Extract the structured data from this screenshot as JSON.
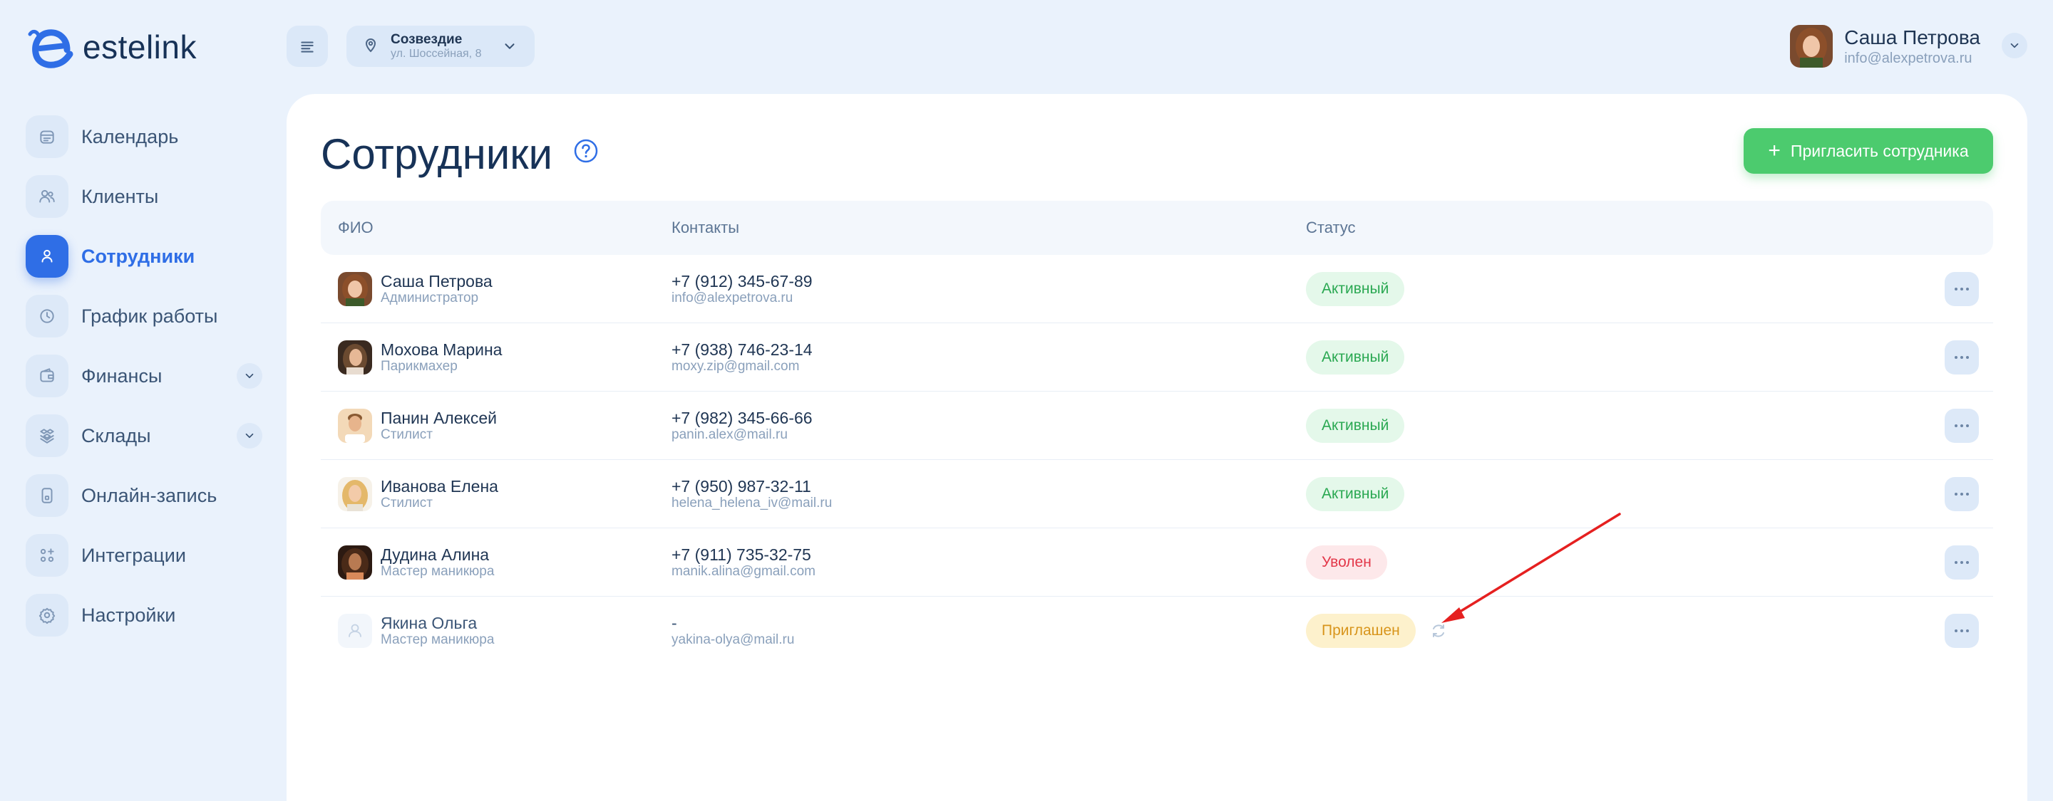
{
  "app": {
    "logo_text": "estelink"
  },
  "sidebar": {
    "items": [
      {
        "label": "Календарь",
        "icon": "calendar-icon"
      },
      {
        "label": "Клиенты",
        "icon": "clients-icon"
      },
      {
        "label": "Сотрудники",
        "icon": "user-icon",
        "active": true
      },
      {
        "label": "График работы",
        "icon": "clock-icon"
      },
      {
        "label": "Финансы",
        "icon": "wallet-icon",
        "expandable": true
      },
      {
        "label": "Склады",
        "icon": "boxes-icon",
        "expandable": true
      },
      {
        "label": "Онлайн-запись",
        "icon": "phone-icon"
      },
      {
        "label": "Интеграции",
        "icon": "integrations-icon"
      },
      {
        "label": "Настройки",
        "icon": "gear-icon"
      }
    ]
  },
  "topbar": {
    "location_name": "Созвездие",
    "location_address": "ул. Шоссейная, 8",
    "user_name": "Саша Петрова",
    "user_email": "info@alexpetrova.ru"
  },
  "main": {
    "title": "Сотрудники",
    "invite_label": "Пригласить сотрудника",
    "invite_plus": "+",
    "columns": {
      "name": "ФИО",
      "contacts": "Контакты",
      "status": "Статус"
    },
    "rows": [
      {
        "name": "Саша Петрова",
        "role": "Администратор",
        "phone": "+7 (912) 345-67-89",
        "email": "info@alexpetrova.ru",
        "status": "Активный",
        "status_type": "active"
      },
      {
        "name": "Мохова Марина",
        "role": "Парикмахер",
        "phone": "+7 (938) 746-23-14",
        "email": "moxy.zip@gmail.com",
        "status": "Активный",
        "status_type": "active"
      },
      {
        "name": "Панин Алексей",
        "role": "Стилист",
        "phone": "+7 (982) 345-66-66",
        "email": "panin.alex@mail.ru",
        "status": "Активный",
        "status_type": "active"
      },
      {
        "name": "Иванова Елена",
        "role": "Стилист",
        "phone": "+7 (950) 987-32-11",
        "email": "helena_helena_iv@mail.ru",
        "status": "Активный",
        "status_type": "active"
      },
      {
        "name": "Дудина Алина",
        "role": "Мастер маникюра",
        "phone": "+7 (911) 735-32-75",
        "email": "manik.alina@gmail.com",
        "status": "Уволен",
        "status_type": "fired"
      },
      {
        "name": "Якина Ольга",
        "role": "Мастер маникюра",
        "phone": "-",
        "email": "yakina-olya@mail.ru",
        "status": "Приглашен",
        "status_type": "invited"
      }
    ]
  },
  "colors": {
    "accent": "#2f6ee6",
    "invite_green": "#4ccb6e",
    "active": "#2aa852",
    "fired": "#e3384a",
    "invited": "#d8951c",
    "annotation_arrow": "#e52020"
  }
}
